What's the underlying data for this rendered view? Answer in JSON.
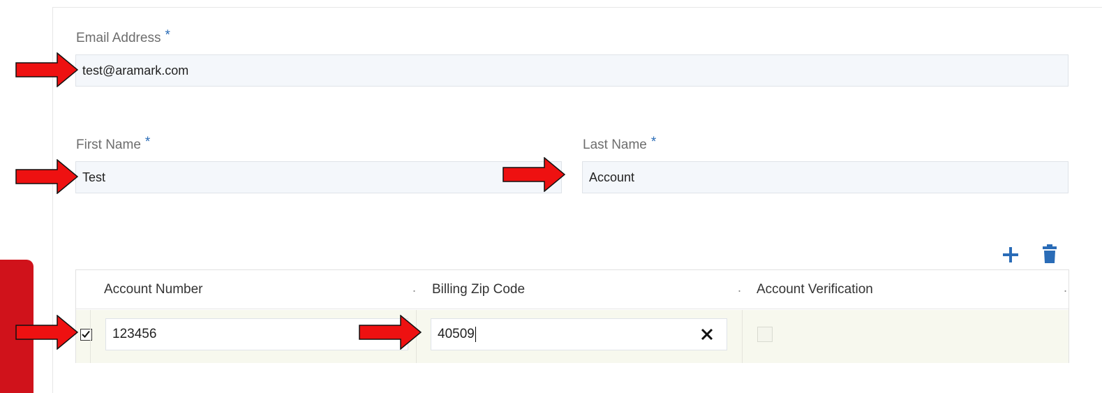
{
  "form": {
    "email": {
      "label": "Email Address",
      "required_mark": "*",
      "value": "test@aramark.com"
    },
    "first_name": {
      "label": "First Name",
      "required_mark": "*",
      "value": "Test"
    },
    "last_name": {
      "label": "Last Name",
      "required_mark": "*",
      "value": "Account"
    }
  },
  "grid": {
    "toolbar": {
      "add_icon": "plus-icon",
      "delete_icon": "trash-icon"
    },
    "columns": [
      {
        "label": "Account Number",
        "menu": "."
      },
      {
        "label": "Billing Zip Code",
        "menu": "."
      },
      {
        "label": "Account Verification",
        "menu": "."
      }
    ],
    "rows": [
      {
        "selected": true,
        "account_number": "123456",
        "billing_zip": "40509",
        "verified": false
      }
    ]
  },
  "colors": {
    "accent": "#2a6cb7",
    "brand_red": "#d0121b",
    "annotation_arrow": "#ee1111",
    "input_bg": "#f4f7fb",
    "row_bg": "#f7f8ee"
  }
}
